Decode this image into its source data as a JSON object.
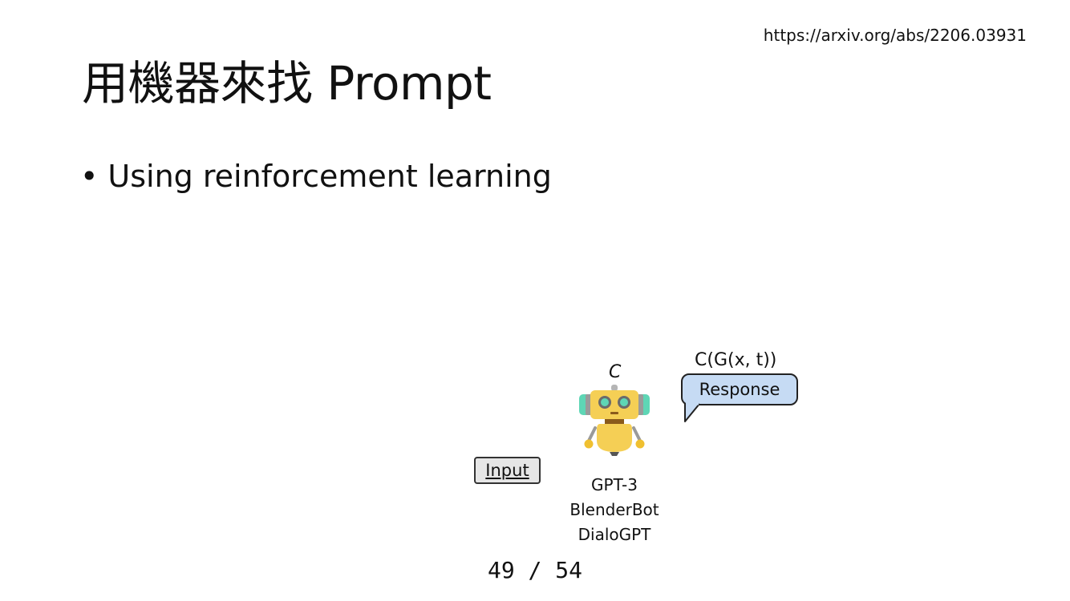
{
  "slide": {
    "source_url": "https://arxiv.org/abs/2206.03931",
    "title": "用機器來找 Prompt",
    "bullets": [
      "Using reinforcement learning"
    ]
  },
  "figure": {
    "classifier_label": "C",
    "output_label": "C(G(x, t))",
    "response_label": "Response",
    "input_label": "Input",
    "models": [
      "GPT-3",
      "BlenderBot",
      "DialoGPT"
    ],
    "robot_icon": "robot-icon",
    "colors": {
      "bubble": "#c6dbf4",
      "robot_body": "#f5cf55",
      "robot_eyes": "#5ed6b5",
      "input_box": "#e6e6e6"
    }
  },
  "footer": {
    "page_indicator": "49 / 54"
  }
}
